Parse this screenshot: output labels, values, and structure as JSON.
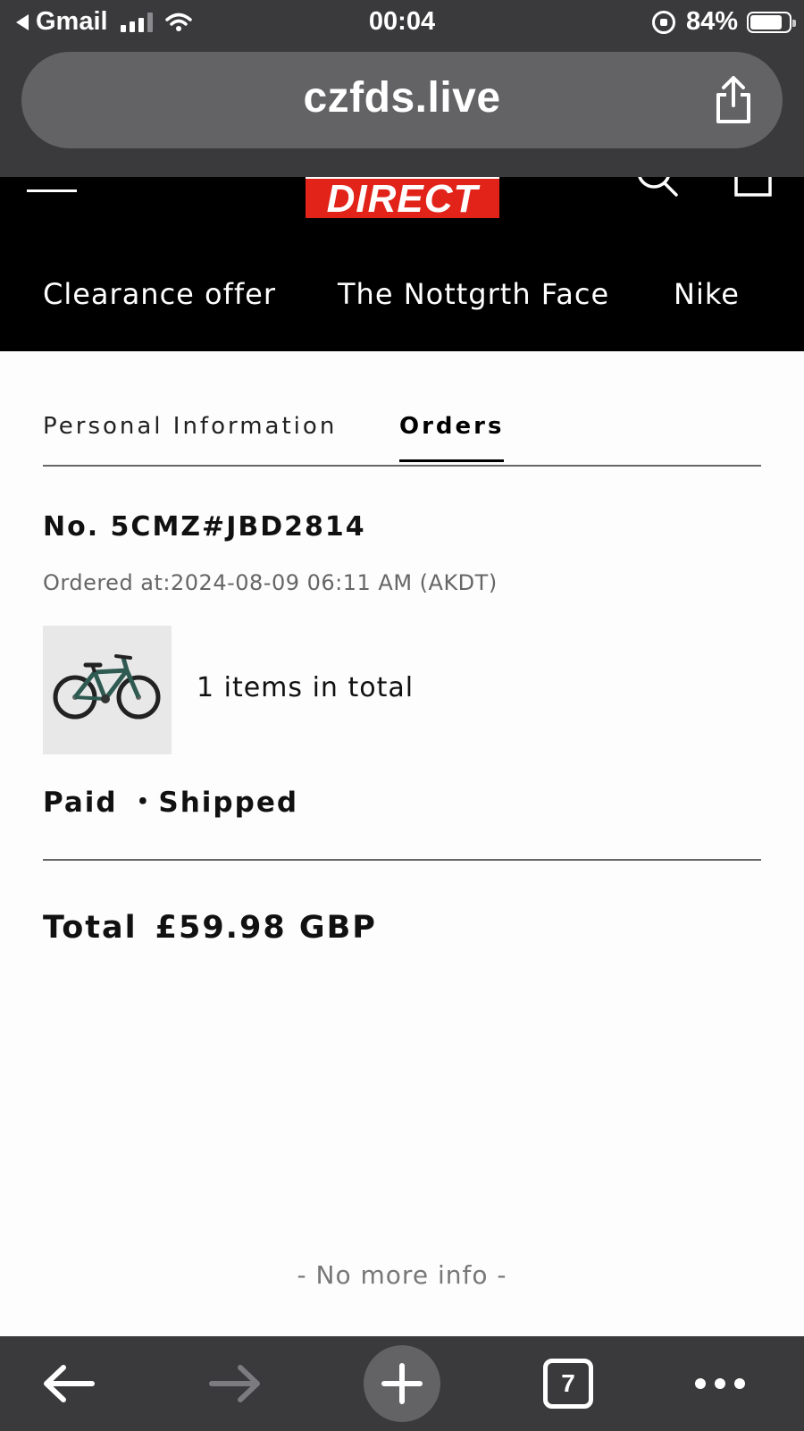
{
  "status_bar": {
    "back_app": "Gmail",
    "time": "00:04",
    "battery": "84%"
  },
  "browser": {
    "url": "czfds.live",
    "tab_count": "7"
  },
  "site": {
    "logo_text": "DIRECT",
    "nav": [
      "Clearance offer",
      "The Nottgrth Face",
      "Nike"
    ]
  },
  "tabs": {
    "personal": "Personal Information",
    "orders": "Orders"
  },
  "order": {
    "number": "No. 5CMZ#JBD2814",
    "ordered_at": "Ordered at:2024-08-09 06:11 AM (AKDT)",
    "items_total": "1 items in total",
    "status": "Paid ・Shipped",
    "total_label": "Total",
    "total_value": "£59.98 GBP"
  },
  "footer": {
    "no_more": "- No more info -"
  },
  "colors": {
    "logo_red": "#e2231a",
    "chrome": "#3a3a3c",
    "bike_green": "#2f5a52"
  },
  "icons": [
    "back-arrow-icon",
    "signal-icon",
    "wifi-icon",
    "rotation-lock-icon",
    "battery-icon",
    "share-icon",
    "menu-icon",
    "search-icon",
    "cart-icon",
    "arrow-left-icon",
    "arrow-right-icon",
    "plus-icon",
    "tabs-icon",
    "more-icon"
  ]
}
